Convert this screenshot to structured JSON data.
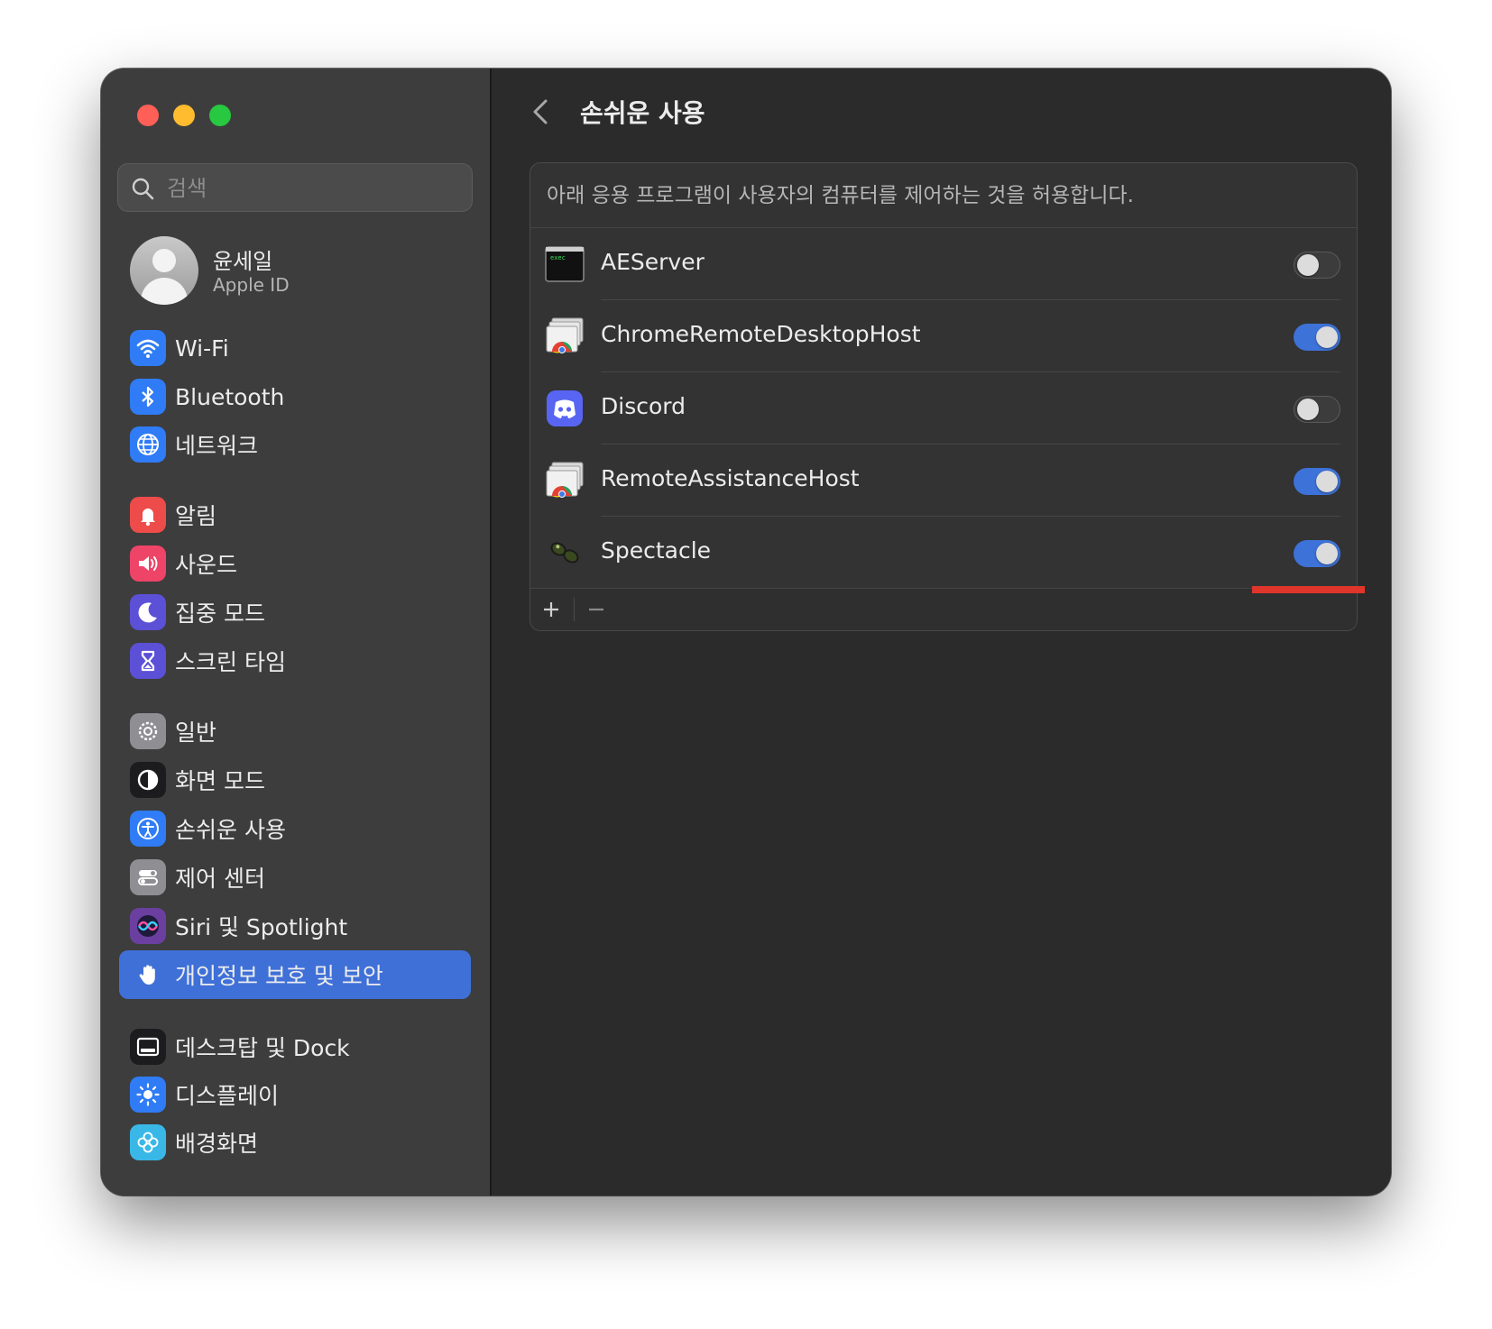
{
  "window": {
    "traffic_lights": {
      "close": "#fe5f57",
      "minimize": "#febc2e",
      "zoom": "#28c840"
    }
  },
  "sidebar": {
    "search_placeholder": "검색",
    "profile": {
      "name": "윤세일",
      "subtitle": "Apple ID"
    },
    "items": [
      {
        "label": "Wi-Fi",
        "icon": "wifi-icon",
        "color": "#2f7cf6"
      },
      {
        "label": "Bluetooth",
        "icon": "bluetooth-icon",
        "color": "#2f7cf6"
      },
      {
        "label": "네트워크",
        "icon": "globe-icon",
        "color": "#2f7cf6"
      },
      {
        "label": "알림",
        "icon": "bell-icon",
        "color": "#ee4b4b"
      },
      {
        "label": "사운드",
        "icon": "speaker-icon",
        "color": "#ee4468"
      },
      {
        "label": "집중 모드",
        "icon": "moon-icon",
        "color": "#5b50d6"
      },
      {
        "label": "스크린 타임",
        "icon": "hourglass-icon",
        "color": "#5b50d6"
      },
      {
        "label": "일반",
        "icon": "gear-icon",
        "color": "#8e8e93"
      },
      {
        "label": "화면 모드",
        "icon": "appearance-icon",
        "color": "#1c1c1e"
      },
      {
        "label": "손쉬운 사용",
        "icon": "accessibility-icon",
        "color": "#2f7cf6"
      },
      {
        "label": "제어 센터",
        "icon": "switches-icon",
        "color": "#8e8e93"
      },
      {
        "label": "Siri 및 Spotlight",
        "icon": "siri-icon",
        "color": "#6b3fa0"
      },
      {
        "label": "개인정보 보호 및 보안",
        "icon": "hand-icon",
        "color": "#3f70d8",
        "selected": true
      },
      {
        "label": "데스크탑 및 Dock",
        "icon": "dock-icon",
        "color": "#1c1c1e"
      },
      {
        "label": "디스플레이",
        "icon": "sun-icon",
        "color": "#2f7cf6"
      },
      {
        "label": "배경화면",
        "icon": "flower-icon",
        "color": "#39b8e8"
      }
    ]
  },
  "content": {
    "title": "손쉬운 사용",
    "description": "아래 응용 프로그램이 사용자의 컴퓨터를 제어하는 것을 허용합니다.",
    "apps": [
      {
        "name": "AEServer",
        "icon": "terminal-exec-icon",
        "enabled": false
      },
      {
        "name": "ChromeRemoteDesktopHost",
        "icon": "chrome-remote-icon",
        "enabled": true
      },
      {
        "name": "Discord",
        "icon": "discord-icon",
        "enabled": false
      },
      {
        "name": "RemoteAssistanceHost",
        "icon": "chrome-remote-icon",
        "enabled": true
      },
      {
        "name": "Spectacle",
        "icon": "spectacle-icon",
        "enabled": true
      }
    ],
    "footer": {
      "add_symbol": "+",
      "remove_symbol": "−"
    },
    "accent": "#3d72d8",
    "highlight_color": "#e0352a"
  }
}
